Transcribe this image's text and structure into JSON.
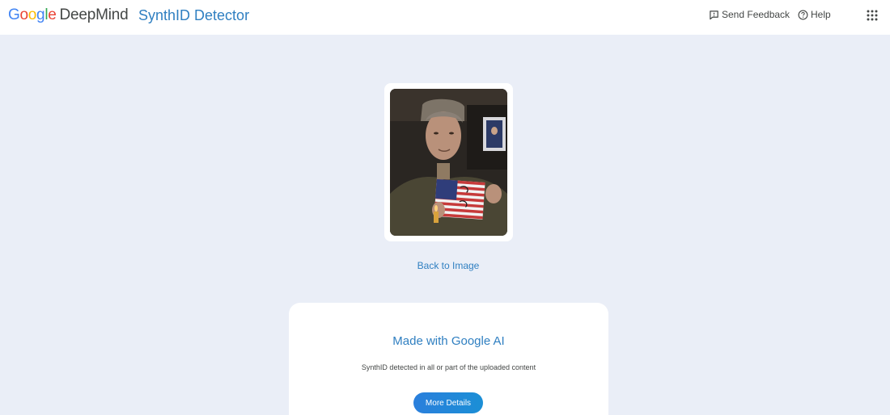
{
  "header": {
    "brand_google_letters": [
      {
        "char": "G",
        "color": "#4285F4"
      },
      {
        "char": "o",
        "color": "#EA4335"
      },
      {
        "char": "o",
        "color": "#FBBC05"
      },
      {
        "char": "g",
        "color": "#4285F4"
      },
      {
        "char": "l",
        "color": "#34A853"
      },
      {
        "char": "e",
        "color": "#EA4335"
      }
    ],
    "brand_deepmind": "DeepMind",
    "product_title": "SynthID Detector",
    "send_feedback_label": "Send Feedback",
    "help_label": "Help",
    "icons": {
      "feedback": "feedback-icon",
      "help": "help-icon",
      "apps": "apps-grid-icon"
    }
  },
  "preview": {
    "image_icon": "uploaded-photo"
  },
  "back_link_label": "Back to Image",
  "result": {
    "title": "Made with Google AI",
    "description": "SynthID detected in all or part of the uploaded content",
    "button_label": "More Details"
  },
  "colors": {
    "accent": "#2f7fc1",
    "button": "#2a7fdc",
    "background": "#eaeef7"
  }
}
